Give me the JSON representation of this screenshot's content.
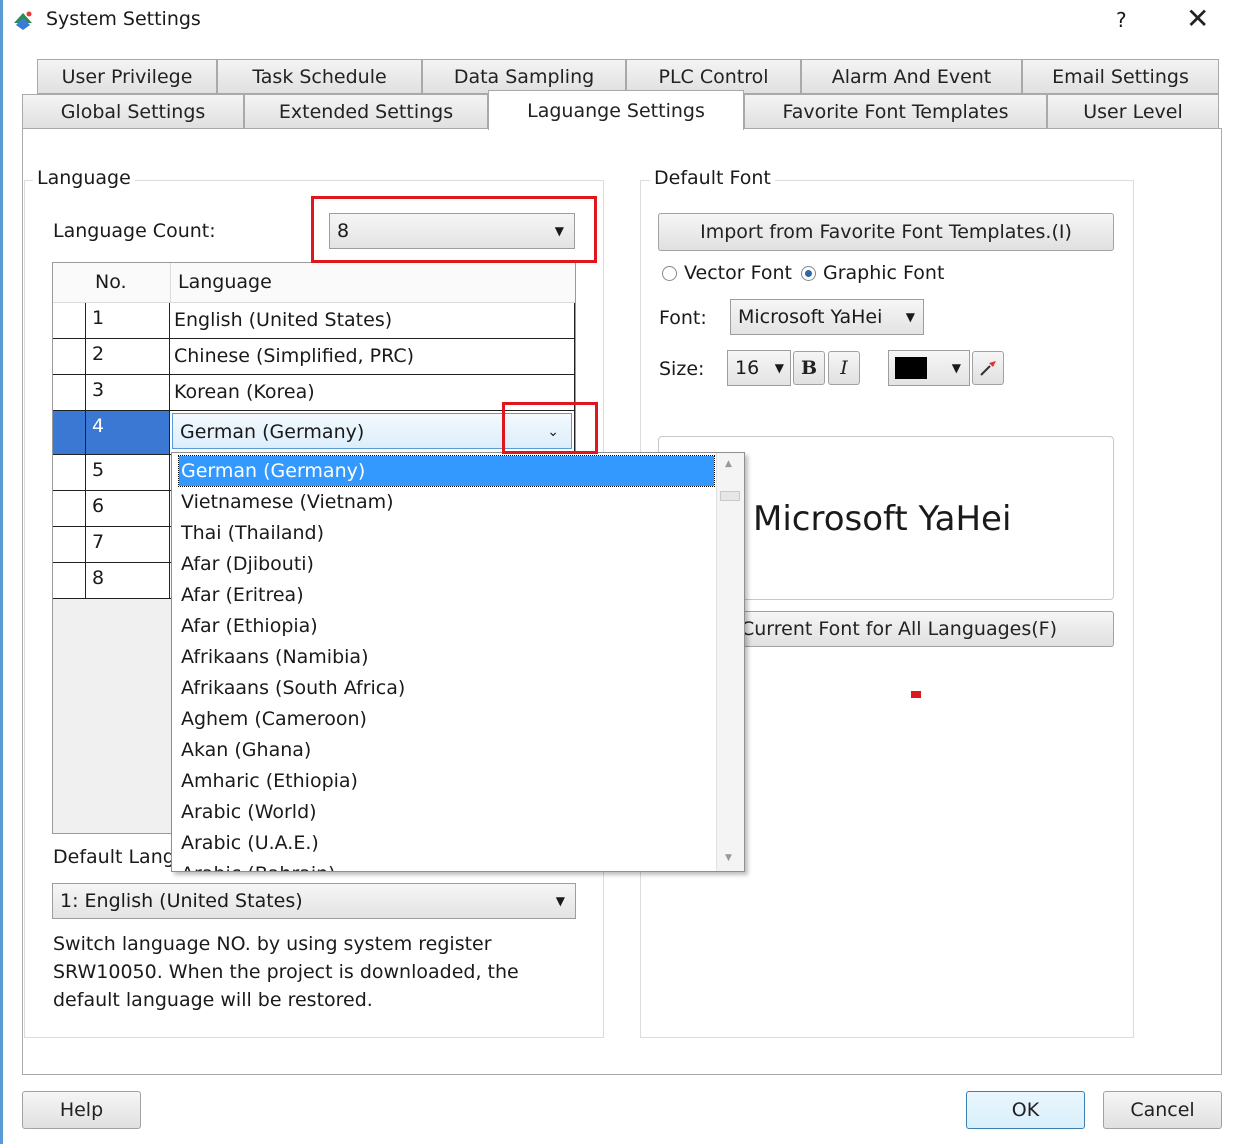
{
  "window": {
    "title": "System Settings",
    "help_label": "?",
    "close_label": "✕"
  },
  "tabs_row1": [
    "User Privilege",
    "Task Schedule",
    "Data Sampling",
    "PLC Control",
    "Alarm And Event",
    "Email Settings"
  ],
  "tabs_row2": [
    "Global Settings",
    "Extended Settings",
    "Laguange Settings",
    "Favorite Font Templates",
    "User Level"
  ],
  "active_tab": "Laguange Settings",
  "language_group": {
    "title": "Language",
    "count_label": "Language Count:",
    "count_value": "8",
    "table": {
      "headers": [
        "No.",
        "Language"
      ],
      "rows": [
        {
          "no": "1",
          "language": "English (United States)"
        },
        {
          "no": "2",
          "language": "Chinese (Simplified, PRC)"
        },
        {
          "no": "3",
          "language": "Korean (Korea)"
        },
        {
          "no": "4",
          "language": "German (Germany)"
        },
        {
          "no": "5",
          "language": ""
        },
        {
          "no": "6",
          "language": ""
        },
        {
          "no": "7",
          "language": ""
        },
        {
          "no": "8",
          "language": ""
        }
      ]
    },
    "dropdown_options": [
      "German (Germany)",
      "Vietnamese (Vietnam)",
      "Thai (Thailand)",
      "Afar (Djibouti)",
      "Afar (Eritrea)",
      "Afar (Ethiopia)",
      "Afrikaans (Namibia)",
      "Afrikaans (South Africa)",
      "Aghem (Cameroon)",
      "Akan (Ghana)",
      "Amharic (Ethiopia)",
      "Arabic (World)",
      "Arabic (U.A.E.)",
      "Arabic (Bahrain)"
    ],
    "default_language_label": "Default Lang",
    "default_language_value": "1:  English (United States)",
    "note": "Switch language NO. by using system register SRW10050. When the project is downloaded, the default language will be restored."
  },
  "default_font_group": {
    "title": "Default Font",
    "import_button": "Import from Favorite Font Templates.(I)",
    "radio_vector": "Vector Font",
    "radio_graphic": "Graphic Font",
    "font_label": "Font:",
    "font_value": "Microsoft YaHei",
    "size_label": "Size:",
    "size_value": "16",
    "bold_label": "B",
    "italic_label": "I",
    "color_value": "#000000",
    "preview_text": "Microsoft YaHei",
    "apply_button": "Current Font for All Languages(F)"
  },
  "footer": {
    "help_button": "Help",
    "ok_button": "OK",
    "cancel_button": "Cancel"
  },
  "colors": {
    "highlight": "#e0161f",
    "selection": "#3399ff"
  }
}
